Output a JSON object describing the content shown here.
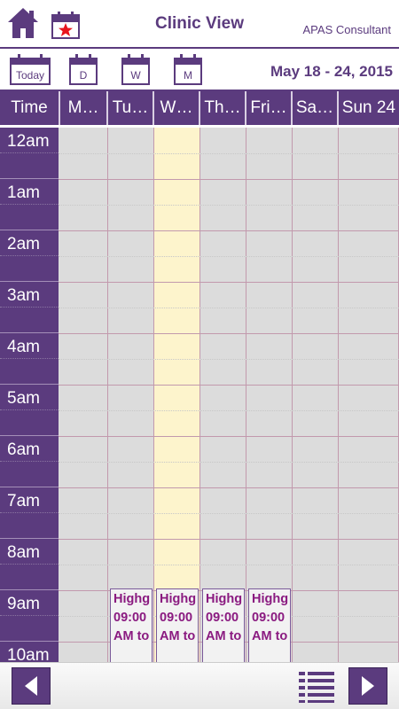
{
  "header": {
    "title": "Clinic View",
    "consultant": "APAS Consultant"
  },
  "toolbar": {
    "today_label": "Today",
    "day_label": "D",
    "week_label": "W",
    "month_label": "M",
    "date_range": "May 18 - 24, 2015"
  },
  "columns": {
    "time": "Time",
    "days": [
      "M…",
      "Tu…",
      "W…",
      "Th…",
      "Fri…",
      "Sa…",
      "Sun 24"
    ]
  },
  "hours": [
    "12am",
    "1am",
    "2am",
    "3am",
    "4am",
    "5am",
    "6am",
    "7am",
    "8am",
    "9am",
    "10am"
  ],
  "appointments": [
    {
      "day": 1,
      "text": "Highg 09:00 AM to"
    },
    {
      "day": 2,
      "text": "Highg 09:00 AM to"
    },
    {
      "day": 3,
      "text": "Highg 09:00 AM to"
    },
    {
      "day": 4,
      "text": "Highg 09:00 AM to"
    }
  ],
  "colors": {
    "brand": "#5b3b7e",
    "today_column": "#fdf4cc",
    "appointment_text": "#8a1a80"
  },
  "icons": {
    "home": "home-icon",
    "favorite": "calendar-star-icon",
    "list": "list-icon",
    "prev": "arrow-left-icon",
    "next": "arrow-right-icon"
  }
}
